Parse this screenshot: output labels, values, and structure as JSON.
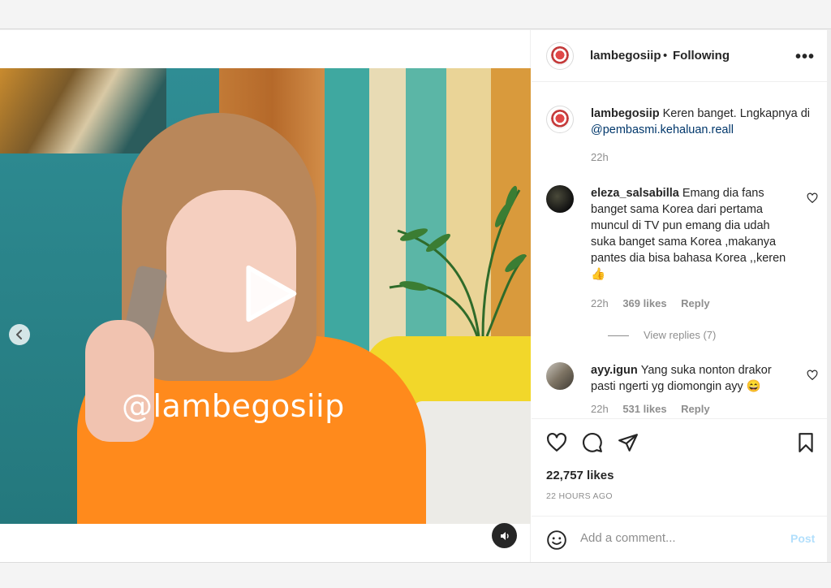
{
  "post": {
    "header": {
      "username": "lambegosiip",
      "separator": "•",
      "follow_status": "Following",
      "more_icon": "more-horizontal-icon"
    },
    "video": {
      "watermark": "@lambegosiip",
      "play_icon": "play-icon",
      "nav_icon": "chevron-left-icon",
      "mute_icon": "speaker-icon"
    },
    "caption": {
      "username": "lambegosiip",
      "text": "Keren banget. Lngkapnya di",
      "mention": "@pembasmi.kehaluan.reall",
      "time": "22h"
    },
    "comments": [
      {
        "username": "eleza_salsabilla",
        "text": "Emang dia fans banget sama Korea dari pertama muncul di TV pun emang dia udah suka banget sama Korea ,makanya pantes dia bisa bahasa Korea ,,keren",
        "emoji": "👍",
        "time": "22h",
        "likes": "369 likes",
        "reply": "Reply",
        "view_replies": "View replies (7)"
      },
      {
        "username": "ayy.igun",
        "text": "Yang suka nonton drakor pasti ngerti yg diomongin ayy",
        "emoji": "😄",
        "time": "22h",
        "likes": "531 likes",
        "reply": "Reply"
      }
    ],
    "actions": {
      "like_icon": "heart-icon",
      "comment_icon": "comment-icon",
      "share_icon": "send-icon",
      "save_icon": "bookmark-icon"
    },
    "likes_count": "22,757 likes",
    "posted_ago": "22 HOURS AGO",
    "add_comment": {
      "placeholder": "Add a comment...",
      "post_label": "Post"
    }
  }
}
